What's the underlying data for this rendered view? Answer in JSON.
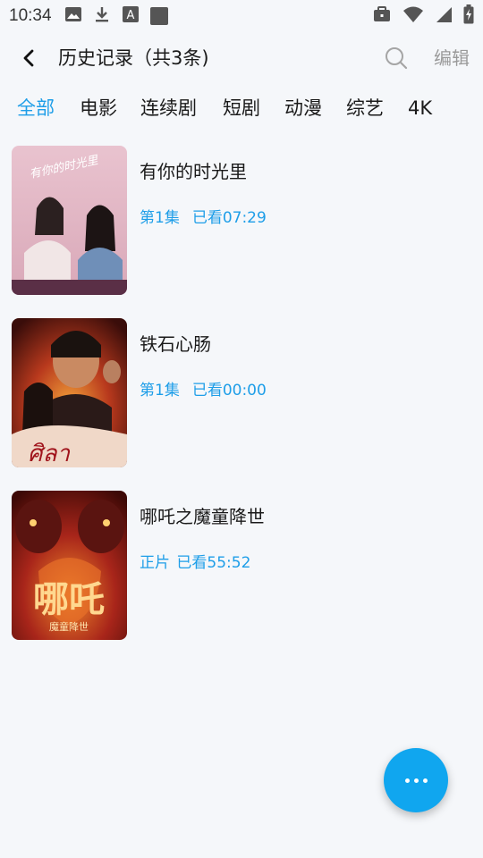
{
  "status_bar": {
    "time": "10:34"
  },
  "header": {
    "title": "历史记录（共3条)",
    "edit_label": "编辑"
  },
  "tabs": [
    {
      "label": "全部",
      "active": true
    },
    {
      "label": "电影",
      "active": false
    },
    {
      "label": "连续剧",
      "active": false
    },
    {
      "label": "短剧",
      "active": false
    },
    {
      "label": "动漫",
      "active": false
    },
    {
      "label": "综艺",
      "active": false
    },
    {
      "label": "4K",
      "active": false
    }
  ],
  "history": [
    {
      "title": "有你的时光里",
      "episode": "第1集",
      "progress": "已看07:29",
      "poster_text": "有你的时光里"
    },
    {
      "title": "铁石心肠",
      "episode": "第1集",
      "progress": "已看00:00",
      "poster_text": "ศิลา"
    },
    {
      "title": "哪吒之魔童降世",
      "episode": "正片",
      "progress": "已看55:52",
      "poster_text": "哪吒之魔童降世"
    }
  ],
  "colors": {
    "accent": "#1e9ee8",
    "fab": "#10a6ef",
    "background": "#f5f7fa"
  }
}
